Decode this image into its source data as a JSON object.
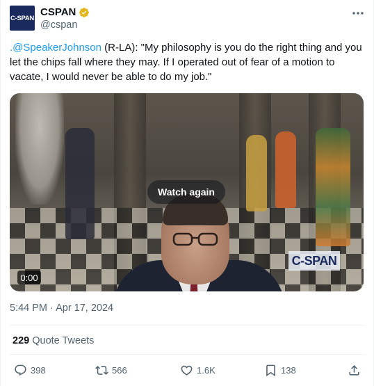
{
  "author": {
    "display_name": "CSPAN",
    "handle": "@cspan",
    "avatar_text": "C-SPAN",
    "verified_color": "#e2b719"
  },
  "tweet": {
    "mention": ".@SpeakerJohnson",
    "text_rest": " (R-LA): \"My philosophy is you do the right thing and you let the chips fall where they may. If I operated out of fear of a motion to vacate, I would never be able to do my job.\""
  },
  "media": {
    "overlay_button": "Watch again",
    "watermark": "C-SPAN",
    "time": "0:00"
  },
  "timestamp": "5:44 PM · Apr 17, 2024",
  "quotes": {
    "count": "229",
    "label": "Quote Tweets"
  },
  "actions": {
    "replies": "398",
    "reposts": "566",
    "likes": "1.6K",
    "bookmarks": "138"
  },
  "colors": {
    "link": "#1d9bf0",
    "muted": "#536471",
    "text": "#0f1419"
  }
}
